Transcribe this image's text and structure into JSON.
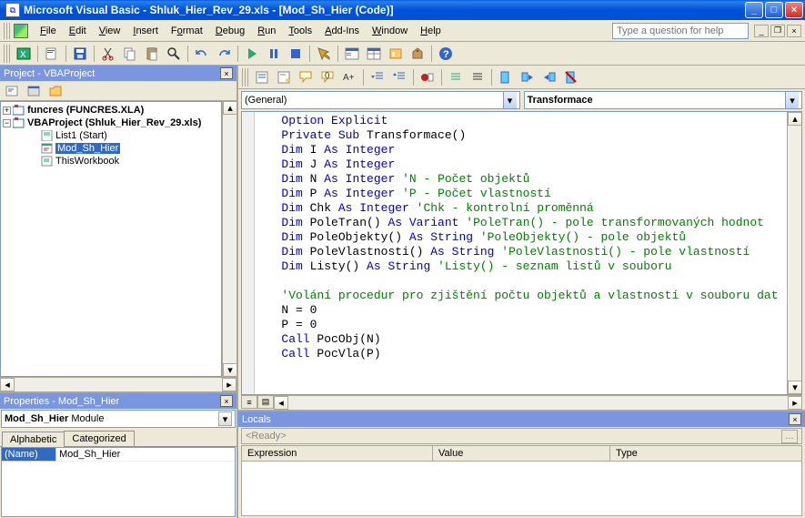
{
  "titlebar": {
    "text": "Microsoft Visual Basic - Shluk_Hier_Rev_29.xls - [Mod_Sh_Hier (Code)]"
  },
  "menu": {
    "file": "File",
    "edit": "Edit",
    "view": "View",
    "insert": "Insert",
    "format": "Format",
    "debug": "Debug",
    "run": "Run",
    "tools": "Tools",
    "addins": "Add-Ins",
    "window": "Window",
    "help": "Help"
  },
  "help_placeholder": "Type a question for help",
  "project": {
    "title": "Project - VBAProject",
    "node1": "funcres (FUNCRES.XLA)",
    "node2": "VBAProject (Shluk_Hier_Rev_29.xls)",
    "leaf1": "List1 (Start)",
    "leaf2": "Mod_Sh_Hier",
    "leaf3": "ThisWorkbook"
  },
  "properties": {
    "title": "Properties - Mod_Sh_Hier",
    "object_name": "Mod_Sh_Hier",
    "object_type": "Module",
    "tab_alpha": "Alphabetic",
    "tab_cat": "Categorized",
    "row_name": "(Name)",
    "row_value": "Mod_Sh_Hier"
  },
  "code": {
    "combo_left": "(General)",
    "combo_right": "Transformace",
    "lines": [
      {
        "t": "Option Explicit",
        "c": "kw"
      },
      {
        "pre": "Private Sub ",
        "preC": "kw",
        "mid": "Transformace()"
      },
      {
        "pre": "Dim ",
        "preC": "kw",
        "mid": "I ",
        "post": "As Integer",
        "postC": "kw"
      },
      {
        "pre": "Dim ",
        "preC": "kw",
        "mid": "J ",
        "post": "As Integer",
        "postC": "kw"
      },
      {
        "pre": "Dim ",
        "preC": "kw",
        "mid": "N ",
        "post": "As Integer ",
        "postC": "kw",
        "cmt": "'N - Počet objektů"
      },
      {
        "pre": "Dim ",
        "preC": "kw",
        "mid": "P ",
        "post": "As Integer ",
        "postC": "kw",
        "cmt": "'P - Počet vlastností"
      },
      {
        "pre": "Dim ",
        "preC": "kw",
        "mid": "Chk ",
        "post": "As Integer ",
        "postC": "kw",
        "cmt": "'Chk - kontrolní proměnná"
      },
      {
        "pre": "Dim ",
        "preC": "kw",
        "mid": "PoleTran() ",
        "post": "As Variant ",
        "postC": "kw",
        "cmt": "'PoleTran() - pole transformovaných hodnot"
      },
      {
        "pre": "Dim ",
        "preC": "kw",
        "mid": "PoleObjekty() ",
        "post": "As String ",
        "postC": "kw",
        "cmt": "'PoleObjekty() - pole objektů"
      },
      {
        "pre": "Dim ",
        "preC": "kw",
        "mid": "PoleVlastnosti() ",
        "post": "As String ",
        "postC": "kw",
        "cmt": "'PoleVlastnosti() - pole vlastností"
      },
      {
        "pre": "Dim ",
        "preC": "kw",
        "mid": "Listy() ",
        "post": "As String ",
        "postC": "kw",
        "cmt": "'Listy() - seznam listů v souboru"
      },
      {
        "t": ""
      },
      {
        "t": "'Volání procedur pro zjištění počtu objektů a vlastností v souboru dat",
        "c": "cm"
      },
      {
        "t": "N = 0"
      },
      {
        "t": "P = 0"
      },
      {
        "pre": "Call ",
        "preC": "kw",
        "mid": "PocObj(N)"
      },
      {
        "pre": "Call ",
        "preC": "kw",
        "mid": "PocVla(P)"
      }
    ]
  },
  "locals": {
    "title": "Locals",
    "ready": "<Ready>",
    "col1": "Expression",
    "col2": "Value",
    "col3": "Type"
  }
}
